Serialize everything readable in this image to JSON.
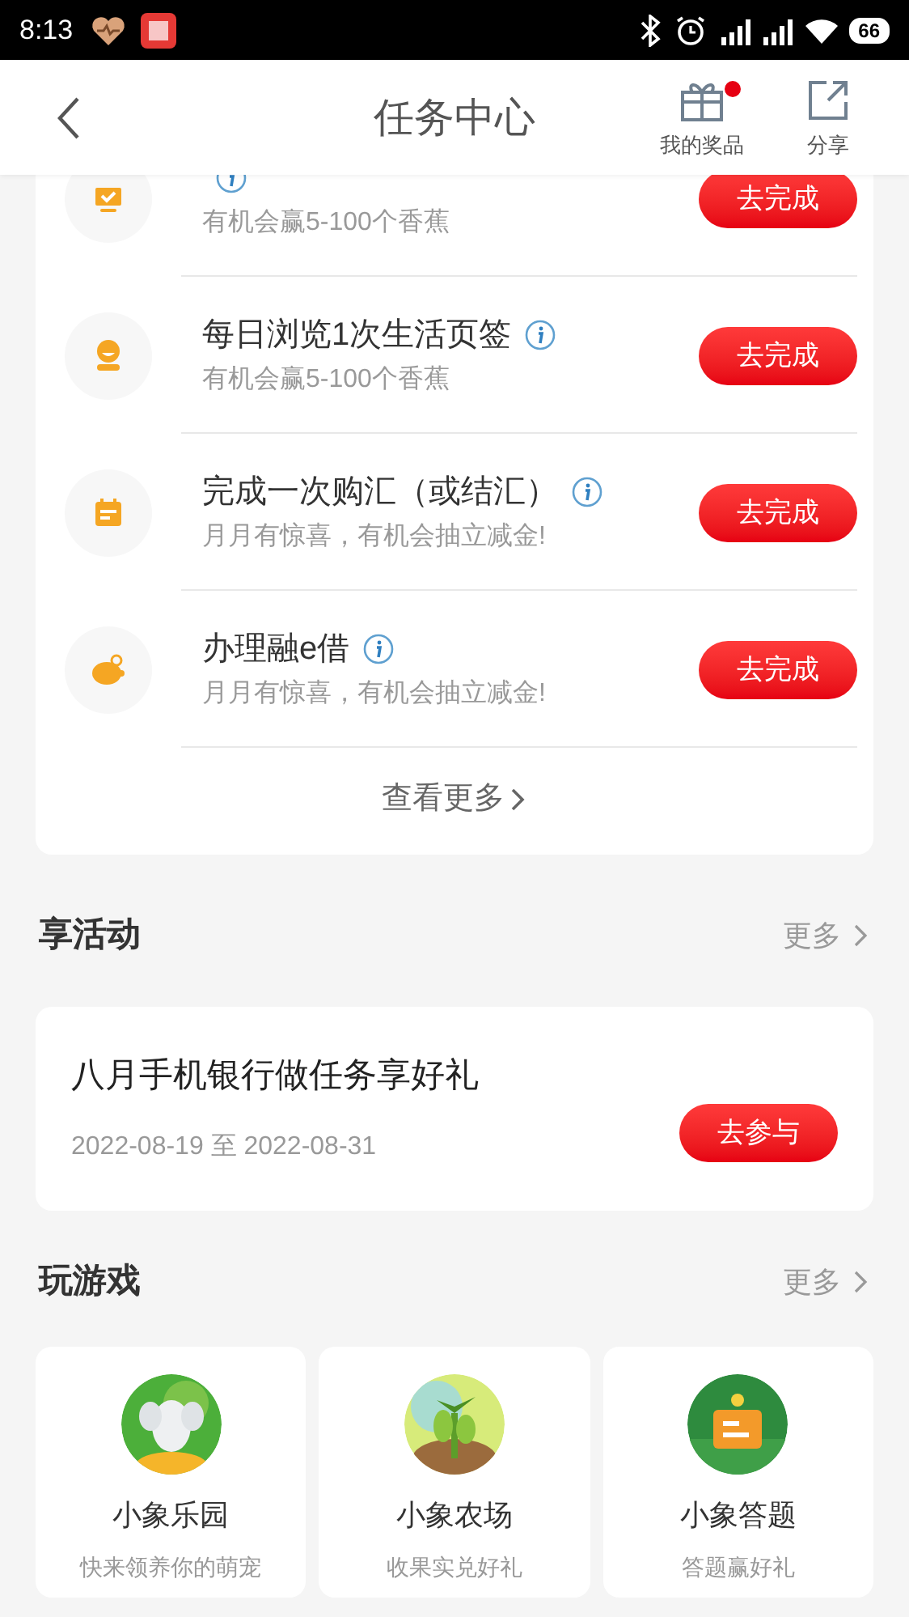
{
  "status_bar": {
    "time": "8:13",
    "battery": "66"
  },
  "header": {
    "title": "任务中心",
    "actions": [
      {
        "label": "我的奖品",
        "dot": true
      },
      {
        "label": "分享",
        "dot": false
      }
    ]
  },
  "tasks": [
    {
      "subtitle": "有机会赢5-100个香蕉",
      "button": "去完成"
    },
    {
      "title": "每日浏览1次生活页签",
      "subtitle": "有机会赢5-100个香蕉",
      "button": "去完成"
    },
    {
      "title": "完成一次购汇（或结汇）",
      "subtitle": "月月有惊喜，有机会抽立减金!",
      "button": "去完成"
    },
    {
      "title": "办理融e借",
      "subtitle": "月月有惊喜，有机会抽立减金!",
      "button": "去完成"
    }
  ],
  "see_more": "查看更多",
  "activities": {
    "heading": "享活动",
    "more": "更多",
    "items": [
      {
        "title": "八月手机银行做任务享好礼",
        "dates": "2022-08-19 至 2022-08-31",
        "button": "去参与"
      }
    ]
  },
  "games": {
    "heading": "玩游戏",
    "more": "更多",
    "items": [
      {
        "title": "小象乐园",
        "subtitle": "快来领养你的萌宠"
      },
      {
        "title": "小象农场",
        "subtitle": "收果实兑好礼"
      },
      {
        "title": "小象答题",
        "subtitle": "答题赢好礼"
      }
    ]
  }
}
